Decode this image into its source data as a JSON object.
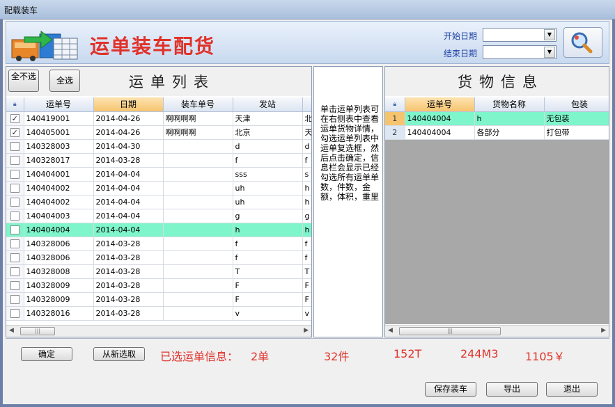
{
  "window": {
    "title": "配载装车"
  },
  "banner": {
    "title": "运单装车配货",
    "start_date_label": "开始日期",
    "end_date_label": "结束日期",
    "start_date_value": "",
    "end_date_value": ""
  },
  "left_panel": {
    "title": "运单列表",
    "deselect_all_label": "全不选",
    "select_all_label": "全选",
    "columns": [
      "运单号",
      "日期",
      "装车单号",
      "发站"
    ],
    "rows": [
      {
        "checked": true,
        "waybill": "140419001",
        "date": "2014-04-26",
        "loading_no": "啊啊啊啊",
        "station": "天津",
        "extra": "北"
      },
      {
        "checked": true,
        "waybill": "140405001",
        "date": "2014-04-26",
        "loading_no": "啊啊啊啊",
        "station": "北京",
        "extra": "天"
      },
      {
        "checked": false,
        "waybill": "140328003",
        "date": "2014-04-30",
        "loading_no": "",
        "station": "d",
        "extra": "d"
      },
      {
        "checked": false,
        "waybill": "140328017",
        "date": "2014-03-28",
        "loading_no": "",
        "station": "f",
        "extra": "f"
      },
      {
        "checked": false,
        "waybill": "140404001",
        "date": "2014-04-04",
        "loading_no": "",
        "station": "sss",
        "extra": "s"
      },
      {
        "checked": false,
        "waybill": "140404002",
        "date": "2014-04-04",
        "loading_no": "",
        "station": "uh",
        "extra": "h"
      },
      {
        "checked": false,
        "waybill": "140404002",
        "date": "2014-04-04",
        "loading_no": "",
        "station": "uh",
        "extra": "h"
      },
      {
        "checked": false,
        "waybill": "140404003",
        "date": "2014-04-04",
        "loading_no": "",
        "station": "g",
        "extra": "g"
      },
      {
        "checked": false,
        "waybill": "140404004",
        "date": "2014-04-04",
        "loading_no": "",
        "station": "h",
        "extra": "h",
        "selected": true
      },
      {
        "checked": false,
        "waybill": "140328006",
        "date": "2014-03-28",
        "loading_no": "",
        "station": "f",
        "extra": "f"
      },
      {
        "checked": false,
        "waybill": "140328006",
        "date": "2014-03-28",
        "loading_no": "",
        "station": "f",
        "extra": "f"
      },
      {
        "checked": false,
        "waybill": "140328008",
        "date": "2014-03-28",
        "loading_no": "",
        "station": "T",
        "extra": "T"
      },
      {
        "checked": false,
        "waybill": "140328009",
        "date": "2014-03-28",
        "loading_no": "",
        "station": "F",
        "extra": "F"
      },
      {
        "checked": false,
        "waybill": "140328009",
        "date": "2014-03-28",
        "loading_no": "",
        "station": "F",
        "extra": "F"
      },
      {
        "checked": false,
        "waybill": "140328016",
        "date": "2014-03-28",
        "loading_no": "",
        "station": "v",
        "extra": "v"
      }
    ]
  },
  "hint": {
    "text": "单击运单列表可在右侧表中查看运单货物详情，勾选运单列表中运单复选框，然后点击确定，信息栏会显示已经勾选所有运单单数，件数，金额，体积，重里"
  },
  "right_panel": {
    "title": "货物信息",
    "columns": [
      "运单号",
      "货物名称",
      "包装"
    ],
    "rows": [
      {
        "num": "1",
        "waybill": "140404004",
        "goods": "h",
        "packing": "无包装",
        "selected": true
      },
      {
        "num": "2",
        "waybill": "140404004",
        "goods": "各部分",
        "packing": "打包带"
      }
    ]
  },
  "bottom": {
    "confirm_label": "确定",
    "reselect_label": "从新选取",
    "selected_info_label": "已选运单信息：",
    "orders": "2单",
    "pieces": "32件",
    "weight": "152T",
    "volume": "244M3",
    "amount": "1105￥",
    "save_label": "保存装车",
    "export_label": "导出",
    "exit_label": "退出"
  },
  "colors": {
    "selected_row": "#7ff5cb",
    "title_red": "#e0322a",
    "label_blue": "#1a3fa3"
  }
}
